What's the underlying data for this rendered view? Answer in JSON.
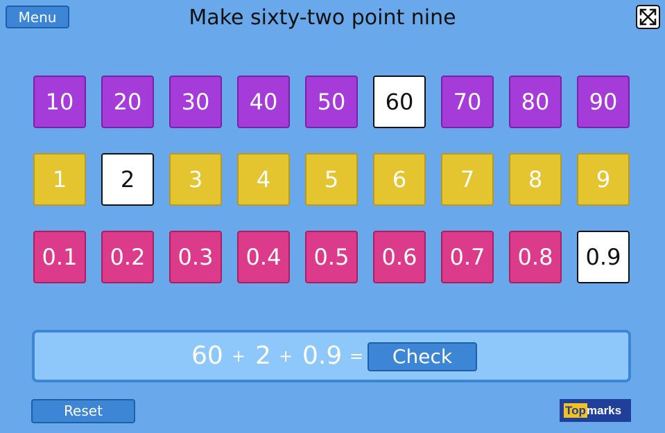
{
  "header": {
    "menu_label": "Menu",
    "title": "Make sixty-two point nine",
    "fullscreen_icon": "fullscreen-exit-icon"
  },
  "rows": {
    "tens": [
      "10",
      "20",
      "30",
      "40",
      "50",
      "60",
      "70",
      "80",
      "90"
    ],
    "ones": [
      "1",
      "2",
      "3",
      "4",
      "5",
      "6",
      "7",
      "8",
      "9"
    ],
    "tenths": [
      "0.1",
      "0.2",
      "0.3",
      "0.4",
      "0.5",
      "0.6",
      "0.7",
      "0.8",
      "0.9"
    ]
  },
  "selected": {
    "tens": "60",
    "ones": "2",
    "tenths": "0.9"
  },
  "colors": {
    "tens": "#a53bd8",
    "ones": "#e4c42f",
    "tenths": "#dc3b8b",
    "background": "#6aa8ec",
    "button": "#3d86d6"
  },
  "answer": {
    "term1": "60",
    "plus1": "+",
    "term2": "2",
    "plus2": "+",
    "term3": "0.9",
    "equals": "=",
    "check_label": "Check"
  },
  "footer": {
    "reset_label": "Reset",
    "logo_part1": "Top",
    "logo_part2": "marks"
  }
}
